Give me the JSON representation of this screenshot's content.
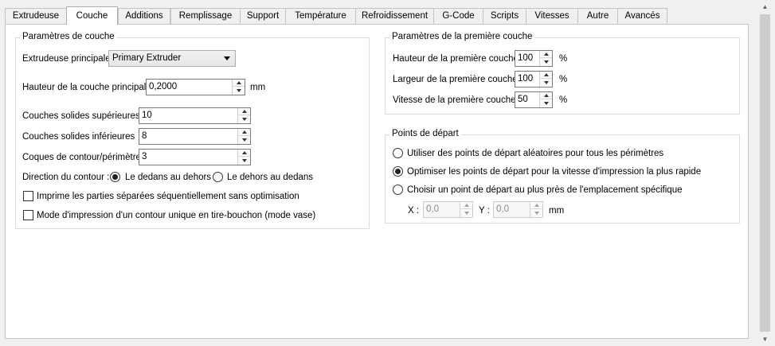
{
  "tabs": [
    {
      "label": "Extrudeuse",
      "active": false
    },
    {
      "label": "Couche",
      "active": true
    },
    {
      "label": "Additions",
      "active": false
    },
    {
      "label": "Remplissage",
      "active": false
    },
    {
      "label": "Support",
      "active": false
    },
    {
      "label": "Température",
      "active": false
    },
    {
      "label": "Refroidissement",
      "active": false
    },
    {
      "label": "G-Code",
      "active": false
    },
    {
      "label": "Scripts",
      "active": false
    },
    {
      "label": "Vitesses",
      "active": false
    },
    {
      "label": "Autre",
      "active": false
    },
    {
      "label": "Avancés",
      "active": false
    }
  ],
  "layer": {
    "title": "Paramètres de couche",
    "extruder_label": "Extrudeuse principale",
    "extruder_value": "Primary Extruder",
    "height_label": "Hauteur de la couche principale",
    "height_value": "0,2000",
    "height_unit": "mm",
    "top_label": "Couches solides supérieures",
    "top_value": "10",
    "bottom_label": "Couches solides inférieures",
    "bottom_value": "8",
    "shells_label": "Coques de contour/périmètre",
    "shells_value": "3",
    "direction_label": "Direction du contour :",
    "dir_inside_out": "Le dedans au dehors",
    "dir_outside_in": "Le dehors au dedans",
    "dir_selected": "inside_out",
    "sequential_label": "Imprime les parties séparées séquentiellement sans optimisation",
    "sequential_checked": false,
    "vase_label": "Mode d'impression d'un contour unique en tire-bouchon (mode vase)",
    "vase_checked": false
  },
  "first_layer": {
    "title": "Paramètres de la première couche",
    "height_label": "Hauteur de la première couche",
    "height_value": "100",
    "width_label": "Largeur de la première couche",
    "width_value": "100",
    "speed_label": "Vitesse de la première couche",
    "speed_value": "50",
    "unit": "%"
  },
  "start_points": {
    "title": "Points de départ",
    "opt_random": "Utiliser des points de départ aléatoires pour tous les périmètres",
    "opt_optimize": "Optimiser les points de départ pour la vitesse d'impression la plus rapide",
    "opt_closest": "Choisir un point de départ au plus près de l'emplacement spécifique",
    "selected": "optimize",
    "x_label": "X :",
    "x_value": "0,0",
    "y_label": "Y :",
    "y_value": "0,0",
    "unit": "mm"
  }
}
